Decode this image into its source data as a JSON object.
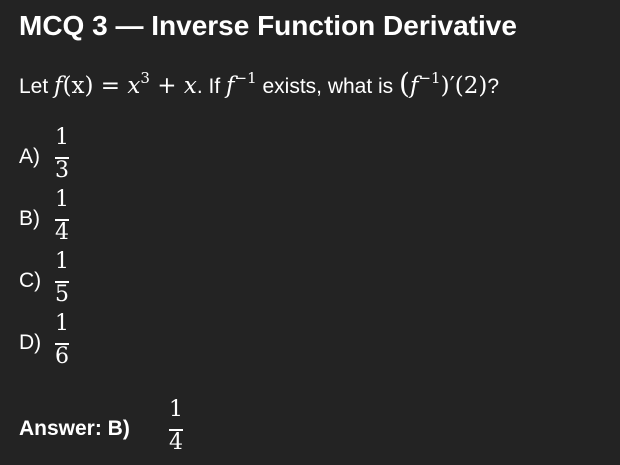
{
  "title": "MCQ 3 — Inverse Function Derivative",
  "question": {
    "prefix": "Let",
    "func_name": "f",
    "func_arg": "(x)",
    "equals": " = ",
    "term1_base": "x",
    "term1_exp": "3",
    "plus": " + ",
    "term2": "x",
    "period": ".",
    "if_text": " If ",
    "inv_name": "f",
    "inv_exp": "−1",
    "exists_text": " exists, what is ",
    "deriv_open": "(",
    "deriv_name": "f",
    "deriv_exp": "−1",
    "deriv_close": ")′(2)",
    "qmark": "?"
  },
  "options": [
    {
      "label": "A)",
      "numerator": "1",
      "denominator": "3"
    },
    {
      "label": "B)",
      "numerator": "1",
      "denominator": "4"
    },
    {
      "label": "C)",
      "numerator": "1",
      "denominator": "5"
    },
    {
      "label": "D)",
      "numerator": "1",
      "denominator": "6"
    }
  ],
  "answer": {
    "label": "Answer: B)",
    "numerator": "1",
    "denominator": "4"
  }
}
